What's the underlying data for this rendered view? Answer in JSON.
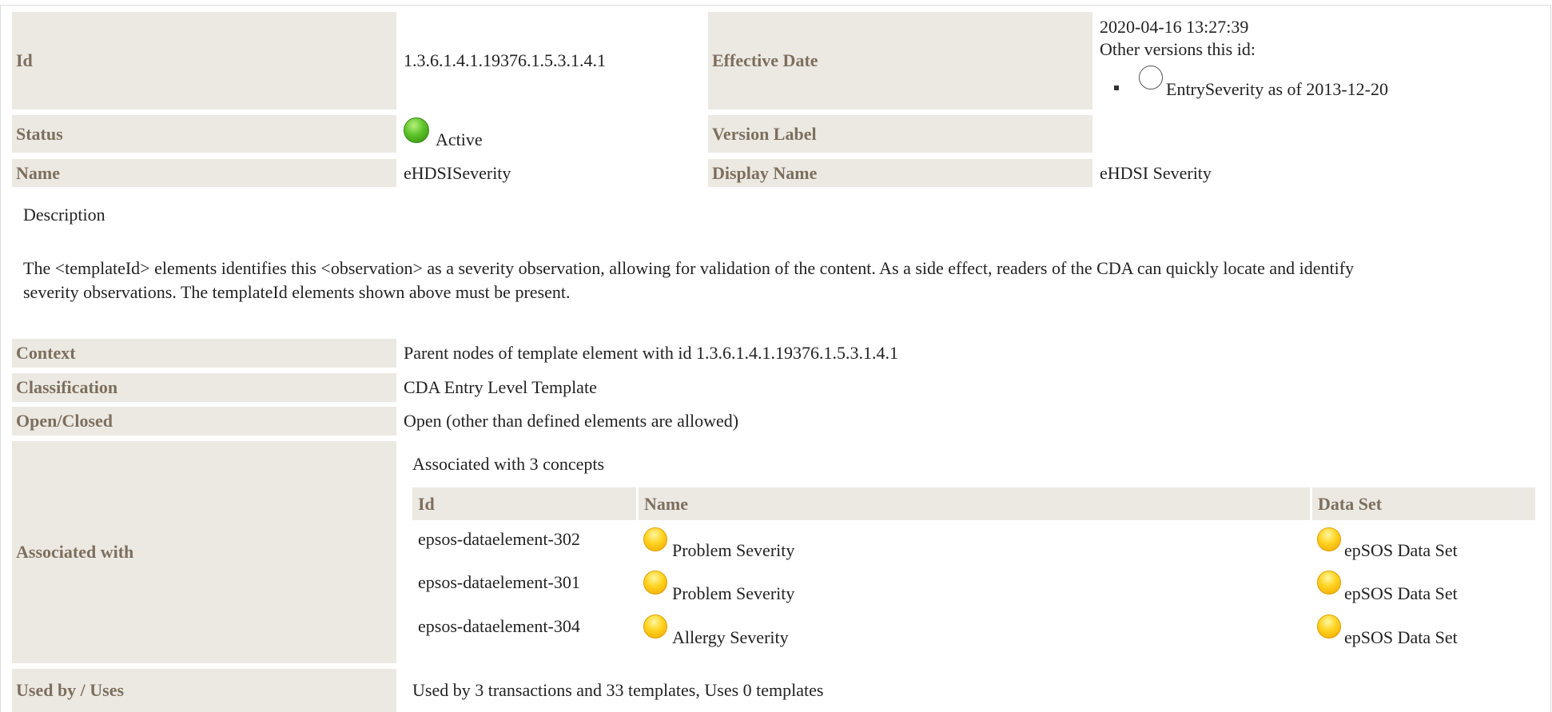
{
  "header": {
    "id_label": "Id",
    "id_value": "1.3.6.1.4.1.19376.1.5.3.1.4.1",
    "effective_date_label": "Effective Date",
    "effective_date_value": "2020-04-16 13:27:39",
    "other_versions_label": "Other versions this id:",
    "other_version_item": "EntrySeverity as of 2013-12-20",
    "status_label": "Status",
    "status_value": "Active",
    "status_color": "#4cb81f",
    "version_label_label": "Version Label",
    "version_label_value": "",
    "name_label": "Name",
    "name_value": "eHDSISeverity",
    "display_name_label": "Display Name",
    "display_name_value": "eHDSI Severity"
  },
  "description": {
    "label": "Description",
    "text_line1": "The <templateId> elements identifies this <observation> as a severity observation, allowing for validation of the content. As a side effect, readers of the CDA can quickly locate and identify",
    "text_line2": "severity observations. The templateId elements shown above must be present."
  },
  "details": {
    "context_label": "Context",
    "context_value": "Parent nodes of template element with id 1.3.6.1.4.1.19376.1.5.3.1.4.1",
    "classification_label": "Classification",
    "classification_value": "CDA Entry Level Template",
    "open_closed_label": "Open/Closed",
    "open_closed_value": "Open (other than defined elements are allowed)",
    "associated_label": "Associated with",
    "associated_summary": "Associated with 3 concepts",
    "used_by_label": "Used by / Uses",
    "used_by_value": "Used by 3 transactions and 33 templates, Uses 0 templates"
  },
  "concepts_table": {
    "columns": [
      "Id",
      "Name",
      "Data Set"
    ],
    "rows": [
      {
        "id": "epsos-dataelement-302",
        "name": "Problem Severity",
        "dataset": "epSOS Data Set"
      },
      {
        "id": "epsos-dataelement-301",
        "name": "Problem Severity",
        "dataset": "epSOS Data Set"
      },
      {
        "id": "epsos-dataelement-304",
        "name": "Allergy Severity",
        "dataset": "epSOS Data Set"
      }
    ],
    "status_icon_color": "#ffcc00"
  },
  "colors": {
    "label_bg": "#ece9e3",
    "label_text": "#7d6f5d"
  }
}
